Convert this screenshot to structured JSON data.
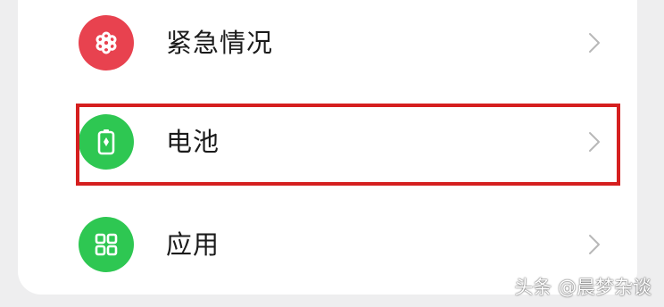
{
  "settings_items": [
    {
      "label": "紧急情况",
      "icon": "emergency-icon",
      "icon_color": "#e8424f"
    },
    {
      "label": "电池",
      "icon": "battery-icon",
      "icon_color": "#2ec752"
    },
    {
      "label": "应用",
      "icon": "apps-grid-icon",
      "icon_color": "#2ec752"
    }
  ],
  "highlight": {
    "color": "#d51f1f",
    "target": "电池"
  },
  "watermark": "头条 @晨梦杂谈",
  "colors": {
    "background": "#eeeeef",
    "card": "#ffffff",
    "text": "#1b1b1b",
    "chevron": "#b8b8b8"
  }
}
